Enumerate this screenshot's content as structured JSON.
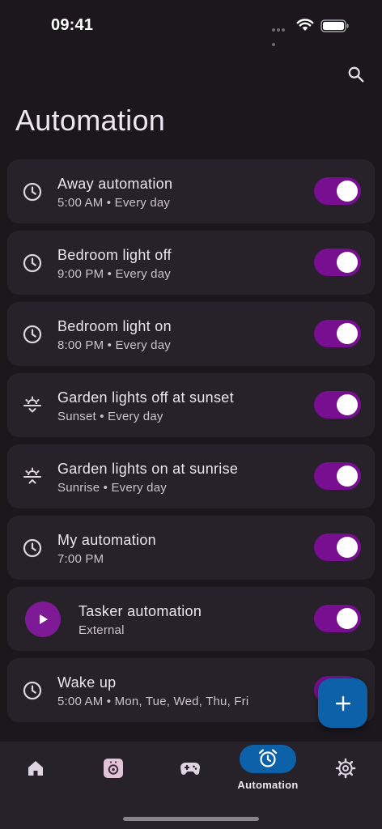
{
  "status_bar": {
    "time": "09:41"
  },
  "header": {
    "title": "Automation"
  },
  "automations": [
    {
      "title": "Away automation",
      "subtitle": "5:00 AM • Every day",
      "icon": "clock-icon",
      "enabled": true
    },
    {
      "title": "Bedroom light off",
      "subtitle": "9:00 PM • Every day",
      "icon": "clock-icon",
      "enabled": true
    },
    {
      "title": "Bedroom light on",
      "subtitle": "8:00 PM • Every day",
      "icon": "clock-icon",
      "enabled": true
    },
    {
      "title": "Garden lights off at sunset",
      "subtitle": "Sunset • Every day",
      "icon": "sunset-icon",
      "enabled": true
    },
    {
      "title": "Garden lights on at sunrise",
      "subtitle": "Sunrise • Every day",
      "icon": "sunrise-icon",
      "enabled": true
    },
    {
      "title": "My automation",
      "subtitle": "7:00 PM",
      "icon": "clock-icon",
      "enabled": true
    },
    {
      "title": "Tasker automation",
      "subtitle": "External",
      "icon": "play-icon",
      "enabled": true
    },
    {
      "title": "Wake up",
      "subtitle": "5:00 AM • Mon, Tue, Wed, Thu, Fri",
      "icon": "clock-icon",
      "enabled": true
    }
  ],
  "fab": {
    "icon": "plus-icon"
  },
  "bottom_nav": {
    "items": [
      {
        "icon": "home-icon",
        "label": ""
      },
      {
        "icon": "device-icon",
        "label": ""
      },
      {
        "icon": "gamepad-icon",
        "label": ""
      },
      {
        "icon": "alarm-clock-icon",
        "label": "Automation",
        "active": true
      },
      {
        "icon": "settings-icon",
        "label": ""
      }
    ]
  },
  "colors": {
    "background": "#1b171d",
    "card": "#272229",
    "toggle_on": "#780f90",
    "accent_blue": "#0c61a8",
    "play_badge": "#7e1a96"
  }
}
